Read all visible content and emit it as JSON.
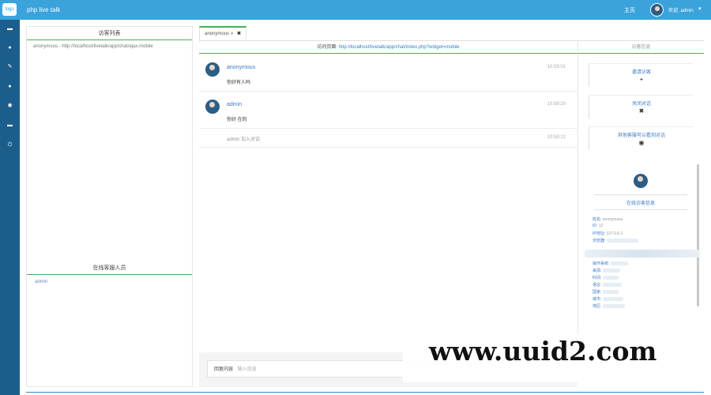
{
  "topbar": {
    "logo_text": "logo",
    "app_title": "php live talk",
    "link_text": "主页",
    "user_text": "欢迎, admin",
    "caret": "▾",
    "bg_color": "#3aa3dc"
  },
  "sidebar": {
    "items": [
      {
        "icon": "chat-icon",
        "glyph": "▬"
      },
      {
        "icon": "location-icon",
        "glyph": "●"
      },
      {
        "icon": "wrench-icon",
        "glyph": "✎"
      },
      {
        "icon": "info-icon",
        "glyph": "●"
      },
      {
        "icon": "eye-icon",
        "glyph": "◉"
      },
      {
        "icon": "window-icon",
        "glyph": "▬"
      },
      {
        "icon": "power-icon",
        "glyph": "⏻"
      }
    ],
    "bg_color": "#1b5d8c"
  },
  "left": {
    "visitors_title": "访客列表",
    "visitors": [
      "anonymous - http://localhost/livetalk/app/chat/ajax.mobile"
    ],
    "online_title": "在线客服人员",
    "online": [
      "admin"
    ]
  },
  "tab": {
    "label": "anonymous",
    "badge": "■",
    "close": "✖"
  },
  "url_bar": {
    "label": "访问页面:",
    "url": "http://localhost/livetalk/app/chat/index.php?widget=mobile"
  },
  "right_header": "访客信息",
  "messages": [
    {
      "name": "anonymous",
      "time": "10:59:01",
      "text": "你好有人吗"
    },
    {
      "name": "admin",
      "time": "10:59:20",
      "text": "你好 在的"
    }
  ],
  "system_message": {
    "text": "admin 加入对话",
    "time": "10:59:12"
  },
  "actions": [
    {
      "label": "邀请访客",
      "glyph": "+",
      "icon": "plus-icon"
    },
    {
      "label": "关闭对话",
      "glyph": "✖",
      "icon": "close-icon"
    },
    {
      "label": "其他客服可以看到对话",
      "glyph": "◉",
      "icon": "eye-icon"
    }
  ],
  "visitor": {
    "status_title": "在线访客信息",
    "fields": [
      {
        "label": "姓名:",
        "value": "anonymous"
      },
      {
        "label": "ID:",
        "value": "12"
      },
      {
        "label": "IP地址:",
        "value": "127.0.0.1"
      },
      {
        "label": "浏览器:",
        "value": ""
      },
      {
        "label": "操作系统:",
        "value": ""
      },
      {
        "label": "来源:",
        "value": ""
      },
      {
        "label": "时间:",
        "value": ""
      },
      {
        "label": "语言:",
        "value": ""
      },
      {
        "label": "国家:",
        "value": ""
      },
      {
        "label": "城市:",
        "value": ""
      },
      {
        "label": "地区:",
        "value": ""
      }
    ]
  },
  "input": {
    "label": "回复内容",
    "placeholder": "输入信息"
  },
  "watermark": "www.uuid2.com"
}
